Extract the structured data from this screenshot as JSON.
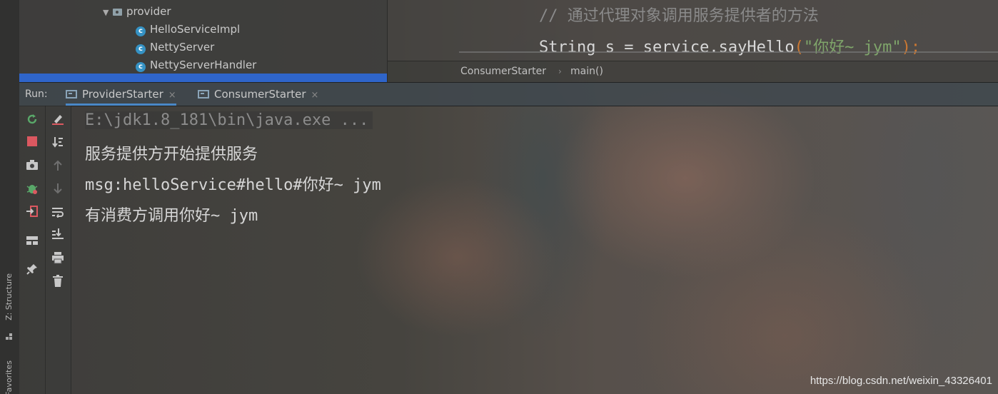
{
  "project_tree": {
    "folder": "provider",
    "items": [
      {
        "label": "HelloServiceImpl",
        "icon": "class-icon"
      },
      {
        "label": "NettyServer",
        "icon": "class-icon"
      },
      {
        "label": "NettyServerHandler",
        "icon": "class-icon"
      }
    ]
  },
  "editor": {
    "comment": "// 通过代理对象调用服务提供者的方法",
    "code": {
      "prefix": "String s = service.sayHello",
      "open_paren": "(",
      "string_literal": "\"你好~ jym\"",
      "close": ");"
    },
    "breadcrumbs": [
      "ConsumerStarter",
      "main()"
    ]
  },
  "run_panel": {
    "label": "Run:",
    "tabs": [
      {
        "label": "ProviderStarter",
        "active": true
      },
      {
        "label": "ConsumerStarter",
        "active": false
      }
    ],
    "close_glyph": "×"
  },
  "console": {
    "lines": [
      "E:\\jdk1.8_181\\bin\\java.exe ...",
      "服务提供方开始提供服务",
      "msg:helloService#hello#你好~ jym",
      "有消费方调用你好~ jym"
    ]
  },
  "side_tabs": {
    "structure": "Z: Structure",
    "favorites": "Favorites"
  },
  "watermark": "https://blog.csdn.net/weixin_43326401",
  "colors": {
    "accent": "#4a88c7",
    "rerun": "#59a869",
    "stop": "#db5860",
    "class_icon": "#3592c4"
  }
}
